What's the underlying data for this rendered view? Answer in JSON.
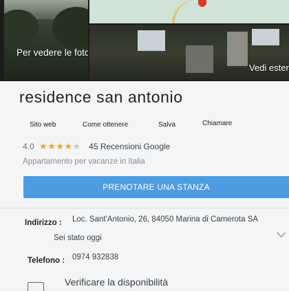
{
  "photos": {
    "left_label": "Per vedere le foto",
    "right_label": "Vedi ester"
  },
  "place": {
    "name": "residence san antonio",
    "actions": [
      "Sito web",
      "Come ottenere",
      "Salva",
      "Chiamare"
    ],
    "rating": {
      "score": "4.0",
      "stars_value": 4,
      "stars_max": 5,
      "reviews": "45 Recensioni Google"
    },
    "category": "Appartamento per vacanze in Italia",
    "book_button": "PRENOTARE UNA STANZA",
    "address": {
      "label": "Indirizzo :",
      "value": "Loc. Sant'Antonio, 26, 84050 Marina di Camerota SA"
    },
    "hours": "Sei stato oggi",
    "phone": {
      "label": "Telefono :",
      "value": "0974 932838"
    },
    "availability": "Verificare la disponibilità"
  },
  "colors": {
    "accent": "#4d9be0",
    "stars": "#e8a33a",
    "text": "#202124"
  }
}
